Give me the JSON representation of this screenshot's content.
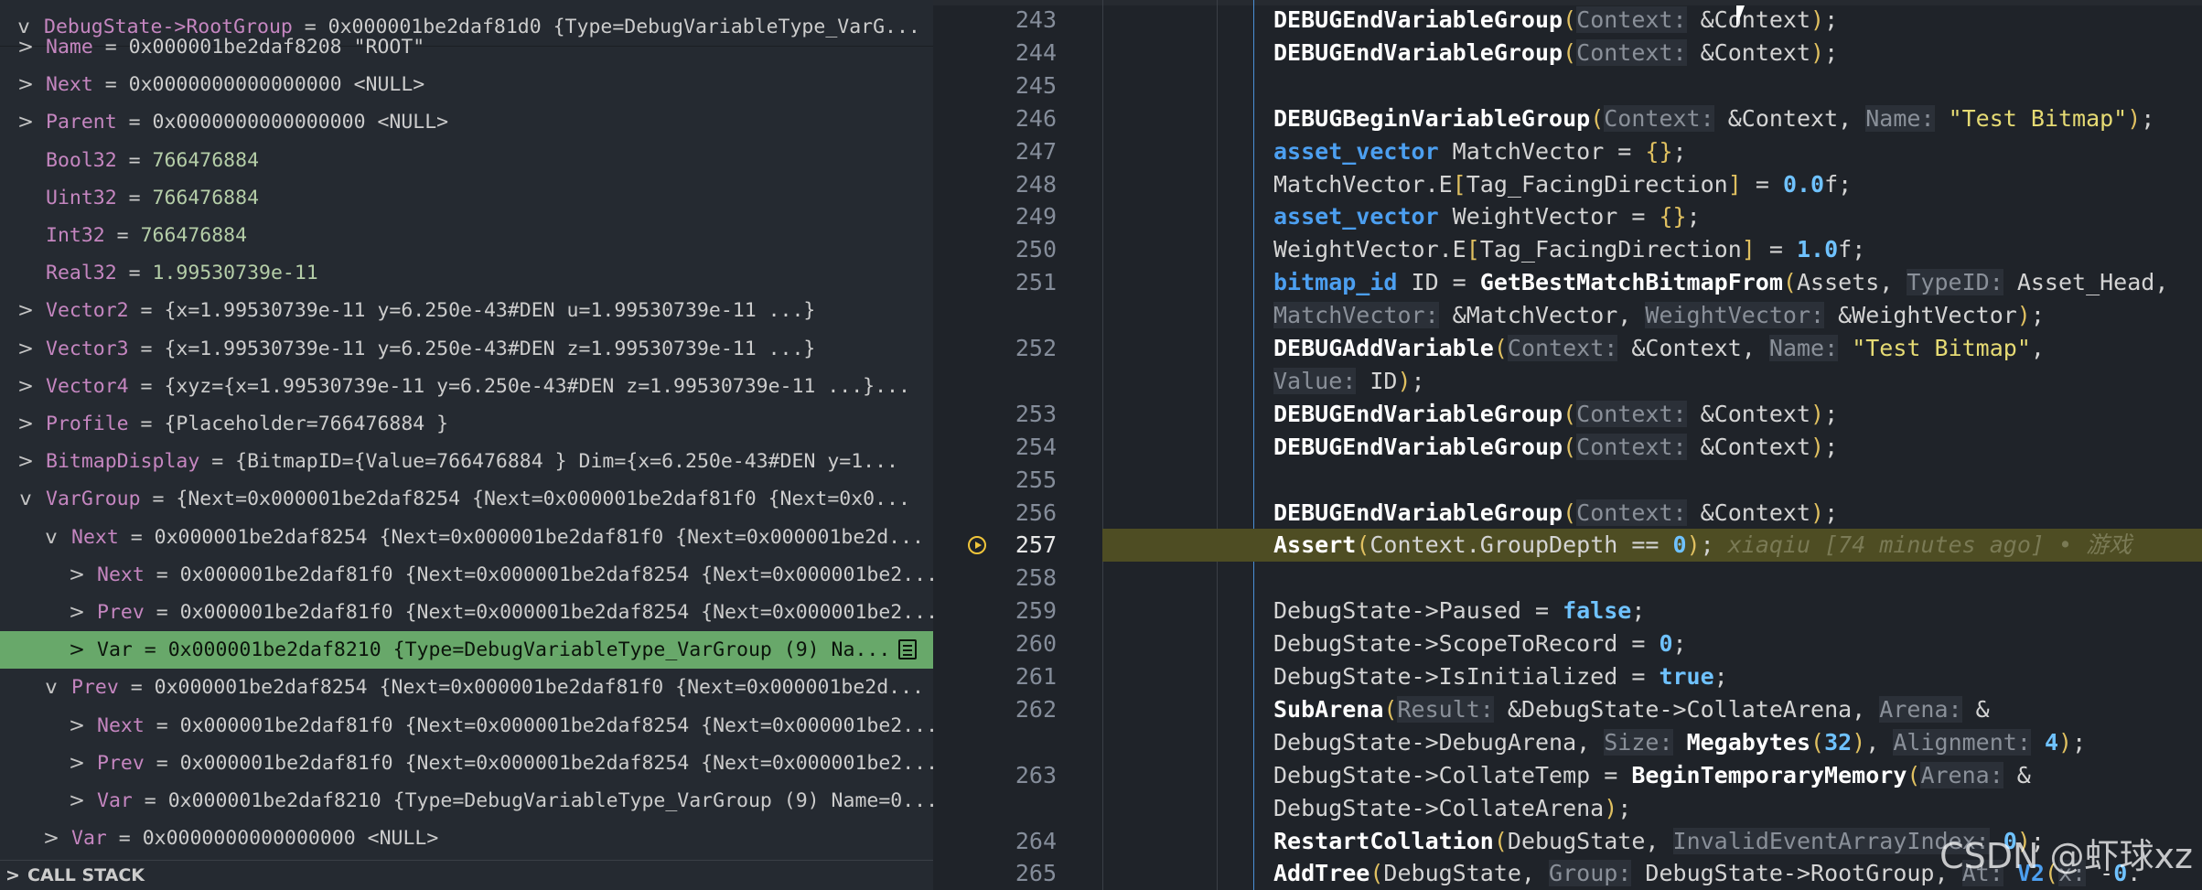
{
  "watch": {
    "header": {
      "name": "DebugState->RootGroup",
      "value": "0x000001be2daf81d0 {Type=DebugVariableType_VarG..."
    },
    "rows": [
      {
        "name": "Name",
        "value": "0x000001be2daf8208 \"ROOT\"",
        "twisty": ">",
        "indent": 1
      },
      {
        "name": "Next",
        "value": "0x0000000000000000 <NULL>",
        "twisty": ">",
        "indent": 1
      },
      {
        "name": "Parent",
        "value": "0x0000000000000000 <NULL>",
        "twisty": ">",
        "indent": 1
      },
      {
        "name": "Bool32",
        "value": "766476884",
        "twisty": "",
        "indent": 1,
        "numeric": true
      },
      {
        "name": "Uint32",
        "value": "766476884",
        "twisty": "",
        "indent": 1,
        "numeric": true
      },
      {
        "name": "Int32",
        "value": "766476884",
        "twisty": "",
        "indent": 1,
        "numeric": true
      },
      {
        "name": "Real32",
        "value": "1.99530739e-11",
        "twisty": "",
        "indent": 1,
        "numeric": true
      },
      {
        "name": "Vector2",
        "value": "{x=1.99530739e-11 y=6.250e-43#DEN u=1.99530739e-11 ...}",
        "twisty": ">",
        "indent": 1
      },
      {
        "name": "Vector3",
        "value": "{x=1.99530739e-11 y=6.250e-43#DEN z=1.99530739e-11 ...}",
        "twisty": ">",
        "indent": 1
      },
      {
        "name": "Vector4",
        "value": "{xyz={x=1.99530739e-11 y=6.250e-43#DEN z=1.99530739e-11 ...}...",
        "twisty": ">",
        "indent": 1
      },
      {
        "name": "Profile",
        "value": "{Placeholder=766476884 }",
        "twisty": ">",
        "indent": 1
      },
      {
        "name": "BitmapDisplay",
        "value": "{BitmapID={Value=766476884 } Dim={x=6.250e-43#DEN y=1...",
        "twisty": ">",
        "indent": 1
      },
      {
        "name": "VarGroup",
        "value": "{Next=0x000001be2daf8254 {Next=0x000001be2daf81f0 {Next=0x0...",
        "twisty": "v",
        "indent": 1
      },
      {
        "name": "Next",
        "value": "0x000001be2daf8254 {Next=0x000001be2daf81f0 {Next=0x000001be2d...",
        "twisty": "v",
        "indent": 2
      },
      {
        "name": "Next",
        "value": "0x000001be2daf81f0 {Next=0x000001be2daf8254 {Next=0x000001be2...",
        "twisty": ">",
        "indent": 3
      },
      {
        "name": "Prev",
        "value": "0x000001be2daf81f0 {Next=0x000001be2daf8254 {Next=0x000001be2...",
        "twisty": ">",
        "indent": 3
      },
      {
        "name": "Var",
        "value": "0x000001be2daf8210 {Type=DebugVariableType_VarGroup (9) Na...",
        "twisty": ">",
        "indent": 3,
        "selected": true
      },
      {
        "name": "Prev",
        "value": "0x000001be2daf8254 {Next=0x000001be2daf81f0 {Next=0x000001be2d...",
        "twisty": "v",
        "indent": 2
      },
      {
        "name": "Next",
        "value": "0x000001be2daf81f0 {Next=0x000001be2daf8254 {Next=0x000001be2...",
        "twisty": ">",
        "indent": 3
      },
      {
        "name": "Prev",
        "value": "0x000001be2daf81f0 {Next=0x000001be2daf8254 {Next=0x000001be2...",
        "twisty": ">",
        "indent": 3
      },
      {
        "name": "Var",
        "value": "0x000001be2daf8210 {Type=DebugVariableType_VarGroup (9) Name=0...",
        "twisty": ">",
        "indent": 3
      },
      {
        "name": "Var",
        "value": "0x0000000000000000 <NULL>",
        "twisty": ">",
        "indent": 2
      }
    ],
    "callstack_label": "CALL STACK"
  },
  "editor": {
    "current_line": "257",
    "rows": [
      {
        "ln": "243",
        "code": [
          [
            "fn",
            "DEBUGEndVariableGroup"
          ],
          [
            "br",
            "("
          ],
          [
            "hint",
            "Context:"
          ],
          [
            "op",
            " &Context"
          ],
          [
            "br",
            ")"
          ],
          [
            "op",
            ";"
          ]
        ]
      },
      {
        "ln": "244",
        "code": [
          [
            "fn",
            "DEBUGEndVariableGroup"
          ],
          [
            "br",
            "("
          ],
          [
            "hint",
            "Context:"
          ],
          [
            "op",
            " &Context"
          ],
          [
            "br",
            ")"
          ],
          [
            "op",
            ";"
          ]
        ]
      },
      {
        "ln": "245",
        "code": []
      },
      {
        "ln": "246",
        "code": [
          [
            "fn",
            "DEBUGBeginVariableGroup"
          ],
          [
            "br",
            "("
          ],
          [
            "hint",
            "Context:"
          ],
          [
            "op",
            " &Context, "
          ],
          [
            "hint",
            "Name:"
          ],
          [
            "str",
            " \"Test Bitmap\""
          ],
          [
            "br",
            ")"
          ],
          [
            "op",
            ";"
          ]
        ]
      },
      {
        "ln": "247",
        "code": [
          [
            "kw",
            "asset_vector"
          ],
          [
            "op",
            " MatchVector = "
          ],
          [
            "br",
            "{}"
          ],
          [
            "op",
            ";"
          ]
        ]
      },
      {
        "ln": "248",
        "code": [
          [
            "op",
            "MatchVector.E"
          ],
          [
            "br",
            "["
          ],
          [
            "op",
            "Tag_FacingDirection"
          ],
          [
            "br",
            "]"
          ],
          [
            "op",
            " = "
          ],
          [
            "num",
            "0.0"
          ],
          [
            "op",
            "f;"
          ]
        ]
      },
      {
        "ln": "249",
        "code": [
          [
            "kw",
            "asset_vector"
          ],
          [
            "op",
            " WeightVector = "
          ],
          [
            "br",
            "{}"
          ],
          [
            "op",
            ";"
          ]
        ]
      },
      {
        "ln": "250",
        "code": [
          [
            "op",
            "WeightVector.E"
          ],
          [
            "br",
            "["
          ],
          [
            "op",
            "Tag_FacingDirection"
          ],
          [
            "br",
            "]"
          ],
          [
            "op",
            " = "
          ],
          [
            "num",
            "1.0"
          ],
          [
            "op",
            "f;"
          ]
        ]
      },
      {
        "ln": "251",
        "code": [
          [
            "kw",
            "bitmap_id"
          ],
          [
            "op",
            " ID = "
          ],
          [
            "fn",
            "GetBestMatchBitmapFrom"
          ],
          [
            "br",
            "("
          ],
          [
            "op",
            "Assets, "
          ],
          [
            "hint",
            "TypeID:"
          ],
          [
            "op",
            " Asset_Head,"
          ]
        ]
      },
      {
        "ln": "",
        "code": [
          [
            "hint",
            "MatchVector:"
          ],
          [
            "op",
            " &MatchVector, "
          ],
          [
            "hint",
            "WeightVector:"
          ],
          [
            "op",
            " &WeightVector"
          ],
          [
            "br",
            ")"
          ],
          [
            "op",
            ";"
          ]
        ]
      },
      {
        "ln": "252",
        "code": [
          [
            "fn",
            "DEBUGAddVariable"
          ],
          [
            "br",
            "("
          ],
          [
            "hint",
            "Context:"
          ],
          [
            "op",
            " &Context, "
          ],
          [
            "hint",
            "Name:"
          ],
          [
            "str",
            " \"Test Bitmap\""
          ],
          [
            "op",
            ","
          ]
        ]
      },
      {
        "ln": "",
        "code": [
          [
            "hint",
            "Value:"
          ],
          [
            "op",
            " ID"
          ],
          [
            "br",
            ")"
          ],
          [
            "op",
            ";"
          ]
        ]
      },
      {
        "ln": "253",
        "code": [
          [
            "fn",
            "DEBUGEndVariableGroup"
          ],
          [
            "br",
            "("
          ],
          [
            "hint",
            "Context:"
          ],
          [
            "op",
            " &Context"
          ],
          [
            "br",
            ")"
          ],
          [
            "op",
            ";"
          ]
        ]
      },
      {
        "ln": "254",
        "code": [
          [
            "fn",
            "DEBUGEndVariableGroup"
          ],
          [
            "br",
            "("
          ],
          [
            "hint",
            "Context:"
          ],
          [
            "op",
            " &Context"
          ],
          [
            "br",
            ")"
          ],
          [
            "op",
            ";"
          ]
        ]
      },
      {
        "ln": "255",
        "code": []
      },
      {
        "ln": "256",
        "code": [
          [
            "fn",
            "DEBUGEndVariableGroup"
          ],
          [
            "br",
            "("
          ],
          [
            "hint",
            "Context:"
          ],
          [
            "op",
            " &Context"
          ],
          [
            "br",
            ")"
          ],
          [
            "op",
            ";"
          ]
        ]
      },
      {
        "ln": "257",
        "code": [
          [
            "fn",
            "Assert"
          ],
          [
            "br",
            "("
          ],
          [
            "op",
            "Context.GroupDepth == "
          ],
          [
            "num",
            "0"
          ],
          [
            "br",
            ")"
          ],
          [
            "op",
            ";"
          ],
          [
            "blame",
            "    xiaqiu [74 minutes ago] • 游戏"
          ]
        ],
        "highlight": true
      },
      {
        "ln": "258",
        "code": []
      },
      {
        "ln": "259",
        "code": [
          [
            "op",
            "DebugState->Paused = "
          ],
          [
            "bool",
            "false"
          ],
          [
            "op",
            ";"
          ]
        ]
      },
      {
        "ln": "260",
        "code": [
          [
            "op",
            "DebugState->ScopeToRecord = "
          ],
          [
            "num",
            "0"
          ],
          [
            "op",
            ";"
          ]
        ]
      },
      {
        "ln": "261",
        "code": [
          [
            "op",
            "DebugState->IsInitialized = "
          ],
          [
            "bool",
            "true"
          ],
          [
            "op",
            ";"
          ]
        ]
      },
      {
        "ln": "262",
        "code": [
          [
            "fn",
            "SubArena"
          ],
          [
            "br",
            "("
          ],
          [
            "hint",
            "Result:"
          ],
          [
            "op",
            " &DebugState->CollateArena, "
          ],
          [
            "hint",
            "Arena:"
          ],
          [
            "op",
            " &"
          ]
        ]
      },
      {
        "ln": "",
        "code": [
          [
            "op",
            "DebugState->DebugArena, "
          ],
          [
            "hint",
            "Size:"
          ],
          [
            "op",
            " "
          ],
          [
            "fn",
            "Megabytes"
          ],
          [
            "br",
            "("
          ],
          [
            "num",
            "32"
          ],
          [
            "br",
            ")"
          ],
          [
            "op",
            ", "
          ],
          [
            "hint",
            "Alignment:"
          ],
          [
            "op",
            " "
          ],
          [
            "num",
            "4"
          ],
          [
            "br",
            ")"
          ],
          [
            "op",
            ";"
          ]
        ]
      },
      {
        "ln": "263",
        "code": [
          [
            "op",
            "DebugState->CollateTemp = "
          ],
          [
            "fn",
            "BeginTemporaryMemory"
          ],
          [
            "br",
            "("
          ],
          [
            "hint",
            "Arena:"
          ],
          [
            "op",
            " &"
          ]
        ]
      },
      {
        "ln": "",
        "code": [
          [
            "op",
            "DebugState->CollateArena"
          ],
          [
            "br",
            ")"
          ],
          [
            "op",
            ";"
          ]
        ]
      },
      {
        "ln": "264",
        "code": [
          [
            "fn",
            "RestartCollation"
          ],
          [
            "br",
            "("
          ],
          [
            "op",
            "DebugState, "
          ],
          [
            "hint",
            "InvalidEventArrayIndex:"
          ],
          [
            "op",
            " "
          ],
          [
            "num",
            "0"
          ],
          [
            "br",
            ")"
          ],
          [
            "op",
            ";"
          ]
        ]
      },
      {
        "ln": "265",
        "code": [
          [
            "fn",
            "AddTree"
          ],
          [
            "br",
            "("
          ],
          [
            "op",
            "DebugState, "
          ],
          [
            "hint",
            "Group:"
          ],
          [
            "op",
            " DebugState->RootGroup, "
          ],
          [
            "hint",
            "At:"
          ],
          [
            "op",
            " "
          ],
          [
            "kw",
            "V2"
          ],
          [
            "br",
            "("
          ],
          [
            "hint",
            "x:"
          ],
          [
            "op",
            " -"
          ],
          [
            "num",
            "0"
          ],
          [
            "op",
            "."
          ]
        ]
      }
    ],
    "watermark": "CSDN @虾球xz"
  },
  "colors": {
    "selected_row": "#68a86a",
    "current_line_bg": "#4e4d23",
    "breakpoint": "#f0c53a"
  }
}
